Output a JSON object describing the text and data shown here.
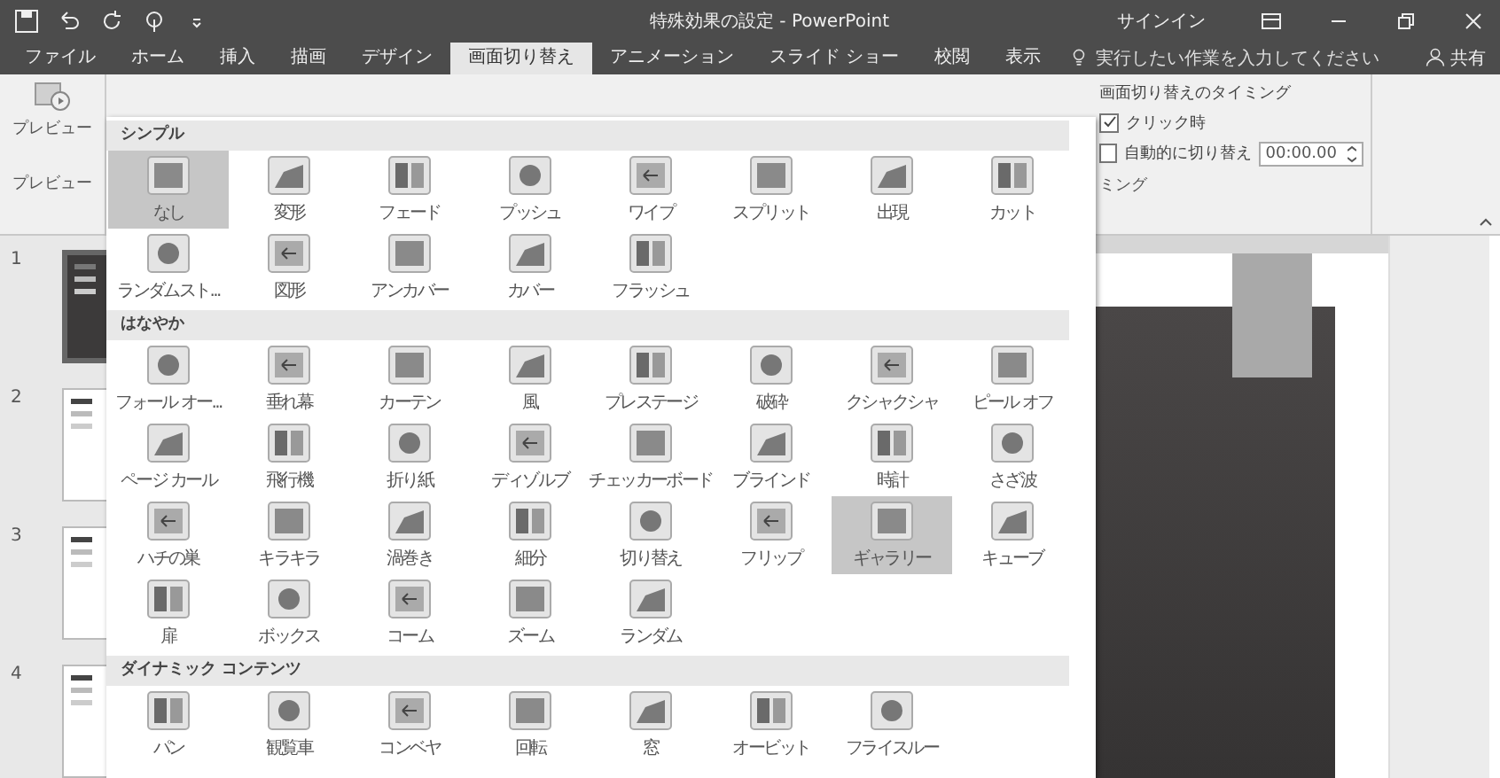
{
  "window": {
    "title": "特殊効果の設定 - PowerPoint",
    "sign_in": "サインイン"
  },
  "tabs": [
    {
      "label": "ファイル",
      "selected": false
    },
    {
      "label": "ホーム",
      "selected": false
    },
    {
      "label": "挿入",
      "selected": false
    },
    {
      "label": "描画",
      "selected": false
    },
    {
      "label": "デザイン",
      "selected": false
    },
    {
      "label": "画面切り替え",
      "selected": true
    },
    {
      "label": "アニメーション",
      "selected": false
    },
    {
      "label": "スライド ショー",
      "selected": false
    },
    {
      "label": "校閲",
      "selected": false
    },
    {
      "label": "表示",
      "selected": false
    }
  ],
  "tell_me": {
    "placeholder": "実行したい作業を入力してください"
  },
  "share": "共有",
  "ribbon": {
    "preview_button": "プレビュー",
    "preview_group": "プレビュー",
    "timing": {
      "title": "画面切り替えのタイミング",
      "group_label": "ミング",
      "options": [
        {
          "label": "クリック時",
          "checked": true
        },
        {
          "label": "自動的に切り替え",
          "checked": false
        }
      ],
      "time": "00:00.00"
    }
  },
  "slides": [
    {
      "number": "1",
      "selected": true,
      "kind": "dark"
    },
    {
      "number": "2",
      "selected": false,
      "kind": "light"
    },
    {
      "number": "3",
      "selected": false,
      "kind": "light"
    },
    {
      "number": "4",
      "selected": false,
      "kind": "light"
    }
  ],
  "gallery": [
    {
      "title": "シンプル",
      "items": [
        {
          "label": "なし",
          "selected": true
        },
        {
          "label": "変形",
          "selected": false
        },
        {
          "label": "フェード",
          "selected": false
        },
        {
          "label": "プッシュ",
          "selected": false
        },
        {
          "label": "ワイプ",
          "selected": false
        },
        {
          "label": "スプリット",
          "selected": false
        },
        {
          "label": "出現",
          "selected": false
        },
        {
          "label": "カット",
          "selected": false
        },
        {
          "label": "ランダムスト...",
          "selected": false
        },
        {
          "label": "図形",
          "selected": false
        },
        {
          "label": "アンカバー",
          "selected": false
        },
        {
          "label": "カバー",
          "selected": false
        },
        {
          "label": "フラッシュ",
          "selected": false
        }
      ]
    },
    {
      "title": "はなやか",
      "items": [
        {
          "label": "フォール オー...",
          "selected": false
        },
        {
          "label": "垂れ幕",
          "selected": false
        },
        {
          "label": "カーテン",
          "selected": false
        },
        {
          "label": "風",
          "selected": false
        },
        {
          "label": "プレステージ",
          "selected": false
        },
        {
          "label": "破砕",
          "selected": false
        },
        {
          "label": "クシャクシャ",
          "selected": false
        },
        {
          "label": "ピール オフ",
          "selected": false
        },
        {
          "label": "ページ カール",
          "selected": false
        },
        {
          "label": "飛行機",
          "selected": false
        },
        {
          "label": "折り紙",
          "selected": false
        },
        {
          "label": "ディゾルブ",
          "selected": false
        },
        {
          "label": "チェッカーボード",
          "selected": false
        },
        {
          "label": "ブラインド",
          "selected": false
        },
        {
          "label": "時計",
          "selected": false
        },
        {
          "label": "さざ波",
          "selected": false
        },
        {
          "label": "ハチの巣",
          "selected": false
        },
        {
          "label": "キラキラ",
          "selected": false
        },
        {
          "label": "渦巻き",
          "selected": false
        },
        {
          "label": "細分",
          "selected": false
        },
        {
          "label": "切り替え",
          "selected": false
        },
        {
          "label": "フリップ",
          "selected": false
        },
        {
          "label": "ギャラリー",
          "selected": true
        },
        {
          "label": "キューブ",
          "selected": false
        },
        {
          "label": "扉",
          "selected": false
        },
        {
          "label": "ボックス",
          "selected": false
        },
        {
          "label": "コーム",
          "selected": false
        },
        {
          "label": "ズーム",
          "selected": false
        },
        {
          "label": "ランダム",
          "selected": false
        }
      ]
    },
    {
      "title": "ダイナミック コンテンツ",
      "items": [
        {
          "label": "パン",
          "selected": false
        },
        {
          "label": "観覧車",
          "selected": false
        },
        {
          "label": "コンベヤ",
          "selected": false
        },
        {
          "label": "回転",
          "selected": false
        },
        {
          "label": "窓",
          "selected": false
        },
        {
          "label": "オービット",
          "selected": false
        },
        {
          "label": "フライスルー",
          "selected": false
        }
      ]
    }
  ]
}
